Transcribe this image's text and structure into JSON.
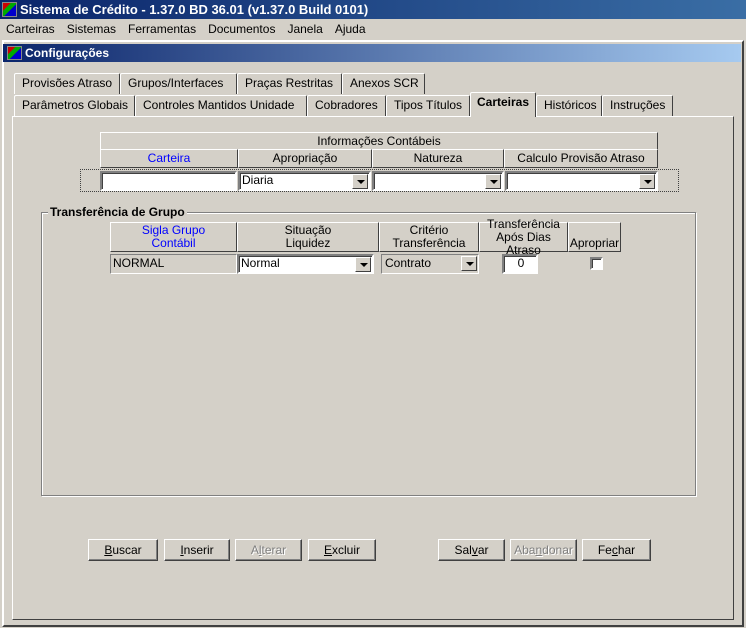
{
  "app": {
    "title": "Sistema de Crédito - 1.37.0 BD 36.01 (v1.37.0 Build 0101)"
  },
  "menu": [
    "Carteiras",
    "Sistemas",
    "Ferramentas",
    "Documentos",
    "Janela",
    "Ajuda"
  ],
  "window": {
    "title": "Configurações"
  },
  "tabs_row1": [
    "Provisões Atraso",
    "Grupos/Interfaces",
    "Praças Restritas",
    "Anexos SCR"
  ],
  "tabs_row2": [
    "Parâmetros Globais",
    "Controles Mantidos Unidade",
    "Cobradores",
    "Tipos Títulos",
    "Carteiras",
    "Históricos",
    "Instruções"
  ],
  "info": {
    "title": "Informações Contábeis",
    "cols": [
      "Carteira",
      "Apropriação",
      "Natureza",
      "Calculo Provisão Atraso"
    ],
    "row": {
      "carteira": "",
      "apropriacao": "Diaria",
      "natureza": "",
      "calculo": ""
    }
  },
  "group": {
    "title": "Transferência de Grupo",
    "cols": [
      [
        "Sigla Grupo",
        "Contábil"
      ],
      [
        "Situação",
        "Liquidez"
      ],
      [
        "Critério",
        "Transferência"
      ],
      [
        "Transferência",
        "Após Dias Atraso"
      ],
      [
        "Apropriar"
      ]
    ],
    "row": {
      "sigla": "NORMAL",
      "situacao": "Normal",
      "criterio": "Contrato",
      "dias": "0",
      "apropriar": false
    }
  },
  "buttons": [
    {
      "pre": "",
      "key": "B",
      "post": "uscar",
      "enabled": true
    },
    {
      "pre": "",
      "key": "I",
      "post": "nserir",
      "enabled": true
    },
    {
      "pre": "A",
      "key": "l",
      "post": "terar",
      "enabled": false
    },
    {
      "pre": "",
      "key": "E",
      "post": "xcluir",
      "enabled": true
    },
    {
      "pre": "Sal",
      "key": "v",
      "post": "ar",
      "enabled": true
    },
    {
      "pre": "Aba",
      "key": "n",
      "post": "donar",
      "enabled": false
    },
    {
      "pre": "Fe",
      "key": "c",
      "post": "har",
      "enabled": true
    }
  ]
}
